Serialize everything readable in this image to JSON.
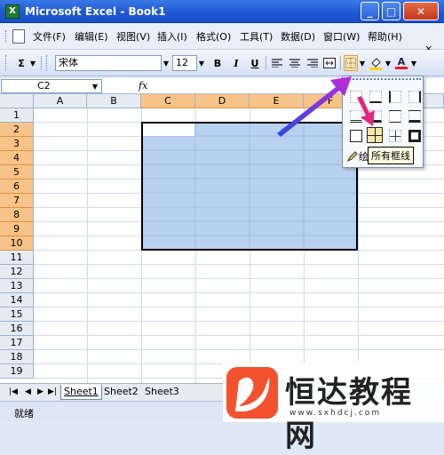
{
  "window": {
    "app_icon_label": "X",
    "title": "Microsoft Excel - Book1",
    "minimize_label": "_",
    "maximize_label": "□",
    "close_label": "✕"
  },
  "menu": {
    "items": [
      {
        "label": "文件(F)"
      },
      {
        "label": "编辑(E)"
      },
      {
        "label": "视图(V)"
      },
      {
        "label": "插入(I)"
      },
      {
        "label": "格式(O)"
      },
      {
        "label": "工具(T)"
      },
      {
        "label": "数据(D)"
      },
      {
        "label": "窗口(W)"
      },
      {
        "label": "帮助(H)"
      }
    ],
    "doc_close_label": "×",
    "doc_min_label": "▾"
  },
  "toolbar": {
    "autosum_label": "Σ",
    "font_name": "宋体",
    "font_size": "12",
    "bold_label": "B",
    "italic_label": "I",
    "underline_label": "U",
    "fill_color": "#ffd200",
    "font_color": "#e02020"
  },
  "formula_bar": {
    "name_box": "C2",
    "fx_label": "fx"
  },
  "grid": {
    "columns": [
      "A",
      "B",
      "C",
      "D",
      "E",
      "F"
    ],
    "selected_columns": [
      "C",
      "D",
      "E",
      "F"
    ],
    "rows": [
      "1",
      "2",
      "3",
      "4",
      "5",
      "6",
      "7",
      "8",
      "9",
      "10",
      "11",
      "12",
      "13",
      "14",
      "15",
      "16",
      "17",
      "18",
      "19"
    ],
    "selected_rows": [
      "2",
      "3",
      "4",
      "5",
      "6",
      "7",
      "8",
      "9",
      "10"
    ],
    "selection_color": "#b8d1f0",
    "header_highlight_color": "#f8c388"
  },
  "sheets": {
    "tabs": [
      "Sheet1",
      "Sheet2",
      "Sheet3"
    ],
    "active": "Sheet1"
  },
  "status": {
    "text": "就绪"
  },
  "border_menu": {
    "draw_label": "绘",
    "tooltip": "所有框线"
  },
  "watermark": {
    "brand": "恒达教程网",
    "url": "www.sxhdcj.com"
  },
  "annotations": {
    "arrow_color": "#7a3fe0",
    "arrow_color_2": "#e0287a"
  }
}
